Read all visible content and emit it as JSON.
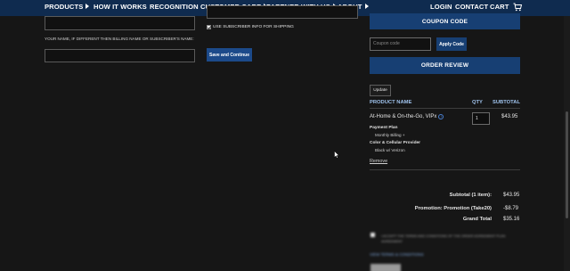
{
  "nav": {
    "left_items": [
      {
        "label": "PRODUCTS",
        "has_caret": true
      },
      {
        "label": "HOW IT WORKS",
        "has_caret": false
      },
      {
        "label": "RECOGNITION",
        "has_caret": false
      },
      {
        "label": "CUSTOMER CARE",
        "has_caret": true
      },
      {
        "label": "PARTNER WITH US",
        "has_caret": true
      },
      {
        "label": "ABOUT",
        "has_caret": true
      }
    ],
    "right_items": [
      {
        "label": "LOGIN"
      },
      {
        "label": "CONTACT"
      },
      {
        "label": "CART"
      }
    ],
    "cart_icon": "shopping-cart-icon"
  },
  "form": {
    "name_label": "YOUR NAME, IF DIFFERENT THEN BILLING NAME OR SUBSCRIBER'S NAME:",
    "name_value": "",
    "top_left_input_value": "",
    "top_middle_input_value": "",
    "shipping_checkbox_label": "USE SUBSCRIBER INFO FOR SHIPPING",
    "shipping_checked": true,
    "save_button": "Save and Continue"
  },
  "sidebar": {
    "coupon_header": "COUPON CODE",
    "coupon_placeholder": "Coupon code",
    "apply_button": "Apply Code",
    "order_review": "ORDER REVIEW",
    "update_button": "Update",
    "columns": {
      "product": "PRODUCT NAME",
      "qty": "QTY",
      "subtotal": "SUBTOTAL"
    },
    "item": {
      "name": "At-Home & On-the-Go, VIPx",
      "info_icon": "info-circle-icon",
      "qty": "1",
      "price": "$43.95",
      "payment_plan_label": "Payment Plan",
      "payment_plan_value": "Monthly Billing +",
      "color_label": "Color & Cellular Provider",
      "color_value": "Black w/ Verizon",
      "remove_link": "Remove"
    },
    "summary": {
      "subtotal_label": "Subtotal (1 item):",
      "subtotal_value": "$43.95",
      "promotion_label": "Promotion: Promotion (Take20)",
      "promotion_value": "-$8.79",
      "grand_total_label": "Grand Total",
      "grand_total_value": "$35.16"
    },
    "terms": {
      "text": "I ACCEPT THE TERMS AND CONDITIONS OF THE ORDER AGREEMENT PLAN AGREEMENT",
      "link": "VIEW TERMS & CONDITIONS",
      "checked": false
    }
  }
}
